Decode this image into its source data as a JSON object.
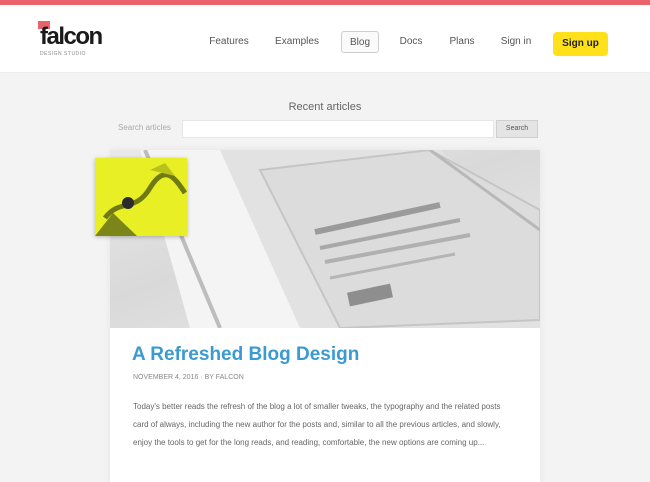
{
  "header": {
    "logo_text": "falcon",
    "logo_sub": "DESIGN STUDIO",
    "nav": [
      {
        "label": "Features"
      },
      {
        "label": "Examples"
      },
      {
        "label": "Blog"
      },
      {
        "label": "Docs"
      },
      {
        "label": "Plans"
      },
      {
        "label": "Sign in"
      }
    ],
    "signup_label": "Sign up"
  },
  "page": {
    "heading": "Recent articles",
    "filter_label": "Search articles",
    "filter_placeholder": "",
    "filter_button": "Search"
  },
  "post": {
    "title": "A Refreshed Blog Design",
    "meta": "NOVEMBER 4, 2016 · BY FALCON",
    "body": "Today's better reads the refresh of the blog a lot of smaller tweaks, the typography and the related posts card of always, including the new author for the posts and, similar to all the previous articles, and slowly, enjoy the tools to get for the long reads, and reading, comfortable, the new options are coming up..."
  },
  "colors": {
    "accent_stripe": "#e8636b",
    "signup_bg": "#ffe11a",
    "title_blue": "#3a9ad1",
    "sticker_yellow": "#e9ef25"
  }
}
